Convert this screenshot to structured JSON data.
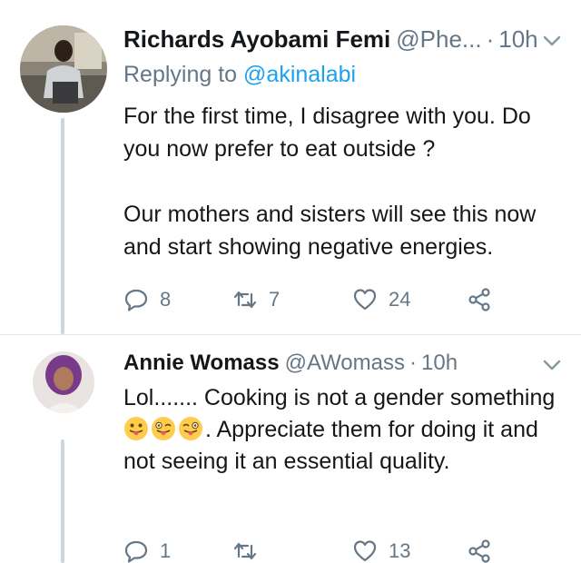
{
  "tweets": [
    {
      "name": "Richards Ayobami Femi",
      "handle": "@Phe...",
      "separator": "·",
      "time": "10h",
      "replying_prefix": "Replying to ",
      "replying_to": "@akinalabi",
      "paragraph_1": "For the first time, I disagree with you. Do you now prefer to eat outside ?",
      "paragraph_2": "Our mothers and sisters will see this now and start showing negative energies.",
      "reply_count": "8",
      "retweet_count": "7",
      "like_count": "24"
    },
    {
      "name": "Annie Womass",
      "handle": "@AWomass",
      "separator": "·",
      "time": "10h",
      "text_1": "Lol....... Cooking is not a gender something ",
      "text_2": ".  Appreciate them for doing it and not seeing it an essential quality.",
      "reply_count": "1",
      "retweet_count": "",
      "like_count": "13"
    }
  ],
  "colors": {
    "text": "#14171a",
    "secondary": "#657786",
    "link": "#1da1f2",
    "line": "#ccd6dd",
    "divider": "#e1e8ed"
  },
  "icons": [
    "reply-icon",
    "retweet-icon",
    "heart-icon",
    "share-icon",
    "chevron-down-icon",
    "tongue-emoji-icon",
    "winking-tongue-emoji-icon"
  ]
}
